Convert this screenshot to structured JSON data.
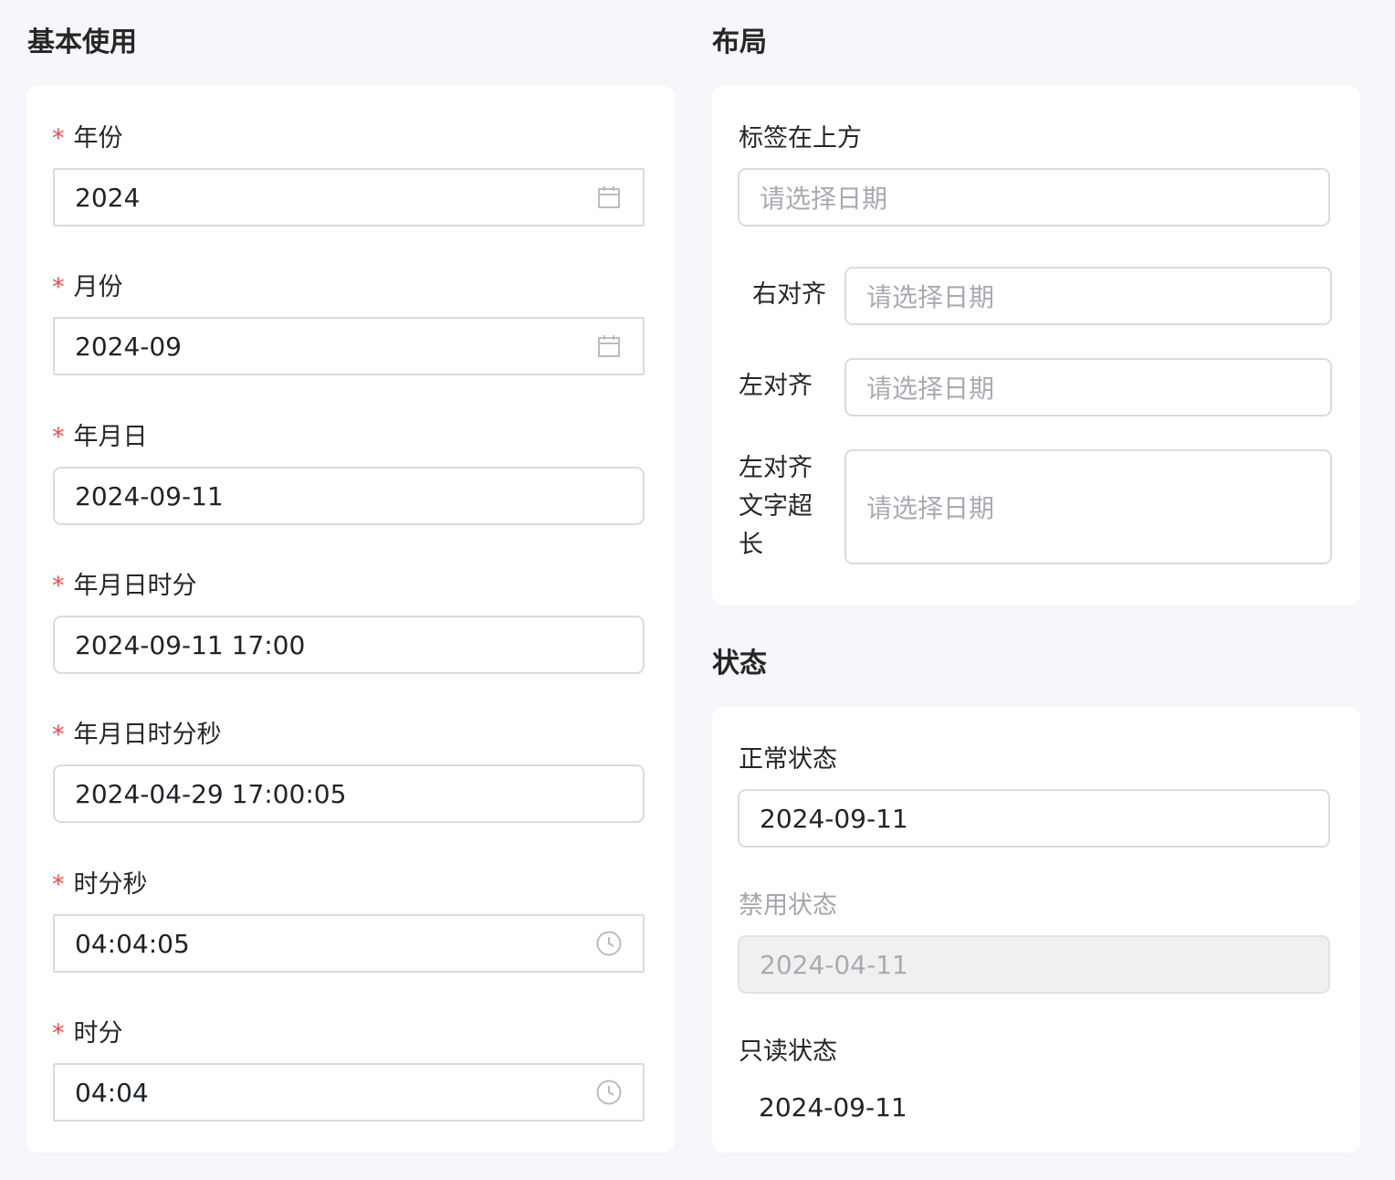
{
  "basic": {
    "title": "基本使用",
    "fields": [
      {
        "label": "年份",
        "value": "2024",
        "icon": "calendar-icon"
      },
      {
        "label": "月份",
        "value": "2024-09",
        "icon": "calendar-icon"
      },
      {
        "label": "年月日",
        "value": "2024-09-11"
      },
      {
        "label": "年月日时分",
        "value": "2024-09-11 17:00"
      },
      {
        "label": "年月日时分秒",
        "value": "2024-04-29 17:00:05"
      },
      {
        "label": "时分秒",
        "value": "04:04:05",
        "icon": "clock-icon"
      },
      {
        "label": "时分",
        "value": "04:04",
        "icon": "clock-icon"
      }
    ],
    "required_mark": "*"
  },
  "layout": {
    "title": "布局",
    "top_label": "标签在上方",
    "right_label": "右对齐",
    "left_label": "左对齐",
    "long_label_lines": [
      "左对齐",
      "文字超",
      "长"
    ],
    "placeholder": "请选择日期"
  },
  "status": {
    "title": "状态",
    "normal_label": "正常状态",
    "normal_value": "2024-09-11",
    "disabled_label": "禁用状态",
    "disabled_value": "2024-04-11",
    "readonly_label": "只读状态",
    "readonly_value": "2024-09-11"
  },
  "colors": {
    "required": "#f04a4a",
    "border": "#d8dbe0",
    "placeholder": "#a8abb2",
    "page_bg": "#f6f7fa"
  }
}
